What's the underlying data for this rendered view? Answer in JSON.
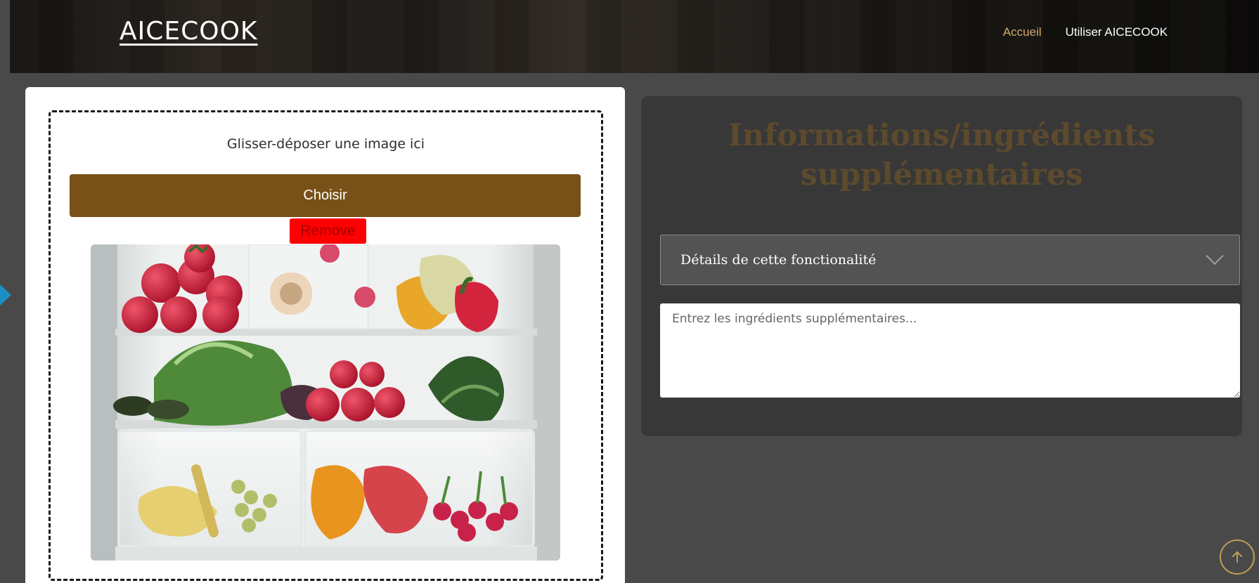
{
  "header": {
    "brand": "AICECOOK",
    "nav": {
      "home": "Accueil",
      "use": "Utiliser AICECOOK"
    }
  },
  "upload": {
    "drop_text": "Glisser-déposer une image ici",
    "choose_label": "Choisir",
    "remove_label": "Remove"
  },
  "info": {
    "title": "Informations/ingrédients supplémentaires",
    "details_label": "Détails de cette fonctionalité",
    "ingredients_placeholder": "Entrez les ingrédients supplémentaires..."
  },
  "colors": {
    "accent": "#785118",
    "nav_active": "#d0a96b",
    "remove": "#ff0000",
    "title": "#5d4a2d"
  },
  "icons": {
    "select_chevron": "chevron-down-icon",
    "scroll_top": "arrow-up-icon"
  }
}
